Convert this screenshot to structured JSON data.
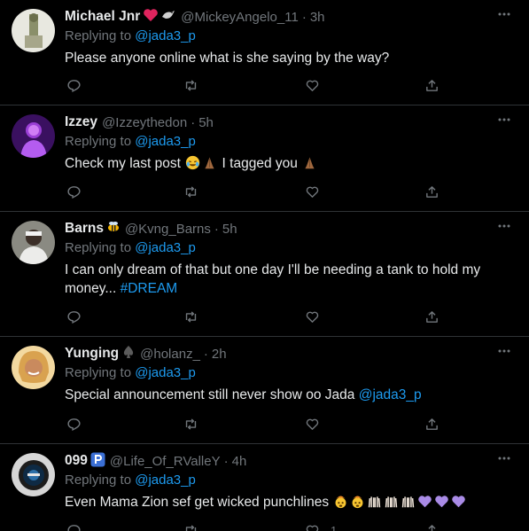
{
  "tweets": [
    {
      "name": "Michael Jnr",
      "name_emoji": [
        "red-heart-icon",
        "eagle-icon"
      ],
      "handle": "@MickeyAngelo_11",
      "dot": "·",
      "time": "3h",
      "replying_prefix": "Replying to ",
      "replying_to": "@jada3_p",
      "text": "Please anyone online what is she saying by the way?",
      "like_count": ""
    },
    {
      "name": "Izzey",
      "name_emoji": [],
      "handle": "@Izzeythedon",
      "dot": "·",
      "time": "5h",
      "replying_prefix": "Replying to ",
      "replying_to": "@jada3_p",
      "text_a": "Check my last post ",
      "text_b": " I tagged you ",
      "emoji": [
        "crying-laughing-emoji",
        "folded-hands-emoji",
        "folded-hands-emoji"
      ],
      "like_count": ""
    },
    {
      "name": "Barns",
      "name_emoji": [
        "bee-icon"
      ],
      "handle": "@Kvng_Barns",
      "dot": "·",
      "time": "5h",
      "replying_prefix": "Replying to ",
      "replying_to": "@jada3_p",
      "text": "I can only dream of that but one day I'll be needing a tank to hold my money... ",
      "hashtag": "#DREAM",
      "like_count": ""
    },
    {
      "name": "Yunging",
      "name_emoji": [
        "spade-icon"
      ],
      "handle": "@holanz_",
      "dot": "·",
      "time": "2h",
      "replying_prefix": "Replying to ",
      "replying_to": "@jada3_p",
      "text": "Special announcement still never show oo Jada ",
      "mention": "@jada3_p",
      "like_count": ""
    },
    {
      "name": "099",
      "name_emoji": [
        "parking-sign-icon"
      ],
      "handle": "@Life_Of_RValleY",
      "dot": "·",
      "time": "4h",
      "replying_prefix": "Replying to ",
      "replying_to": "@jada3_p",
      "text": "Even Mama Zion sef get wicked punchlines ",
      "emoji": [
        "exploding-head-emoji",
        "exploding-head-emoji",
        "raised-hands-emoji",
        "raised-hands-emoji",
        "raised-hands-emoji",
        "purple-heart-emoji",
        "purple-heart-emoji",
        "purple-heart-emoji"
      ],
      "like_count": "1"
    }
  ],
  "icons": {
    "reply": "reply-icon",
    "retweet": "retweet-icon",
    "like": "like-icon",
    "share": "share-icon",
    "more": "more-options-icon"
  },
  "colors": {
    "background": "#000000",
    "name": "#e7e9ea",
    "secondary": "#71767b",
    "link": "#1d9bf0",
    "divider": "#2f3336"
  }
}
